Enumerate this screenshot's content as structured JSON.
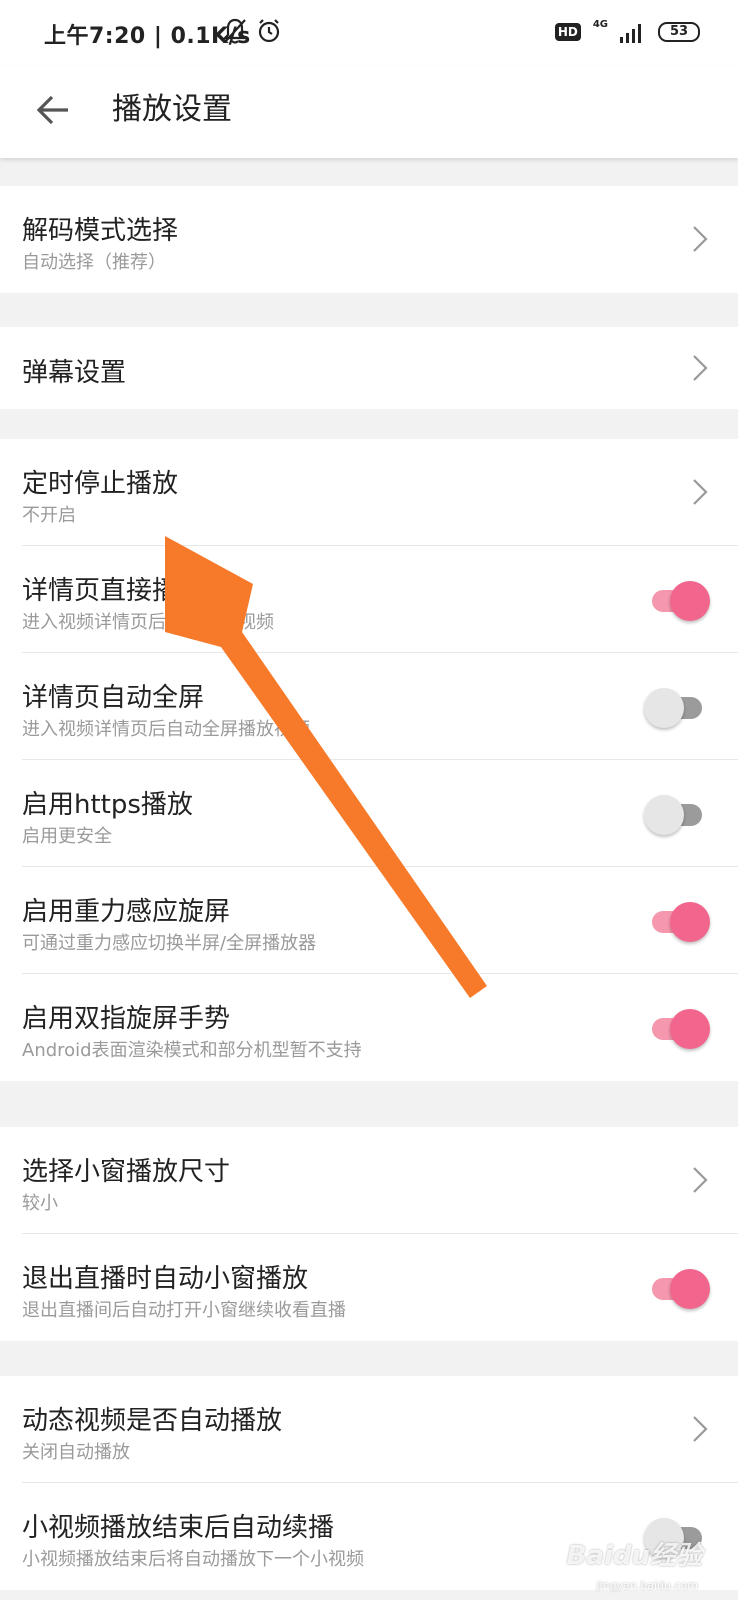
{
  "status_bar": {
    "time_speed": "上午7:20 | 0.1K/s",
    "hd": "HD",
    "network": "4G",
    "battery": "53"
  },
  "app_bar": {
    "title": "播放设置"
  },
  "settings": {
    "decode": {
      "title": "解码模式选择",
      "subtitle": "自动选择（推荐）"
    },
    "danmaku": {
      "title": "弹幕设置"
    },
    "timer": {
      "title": "定时停止播放",
      "subtitle": "不开启"
    },
    "detail_autoplay": {
      "title": "详情页直接播放",
      "subtitle": "进入视频详情页后自动播放视频",
      "enabled": true
    },
    "detail_fullscreen": {
      "title": "详情页自动全屏",
      "subtitle": "进入视频详情页后自动全屏播放视频",
      "enabled": false
    },
    "https": {
      "title": "启用https播放",
      "subtitle": "启用更安全",
      "enabled": false
    },
    "gravity_rotate": {
      "title": "启用重力感应旋屏",
      "subtitle": "可通过重力感应切换半屏/全屏播放器",
      "enabled": true
    },
    "two_finger_rotate": {
      "title": "启用双指旋屏手势",
      "subtitle": "Android表面渲染模式和部分机型暂不支持",
      "enabled": true
    },
    "mini_window_size": {
      "title": "选择小窗播放尺寸",
      "subtitle": "较小"
    },
    "live_mini_window": {
      "title": "退出直播时自动小窗播放",
      "subtitle": "退出直播间后自动打开小窗继续收看直播",
      "enabled": true
    },
    "dynamic_autoplay": {
      "title": "动态视频是否自动播放",
      "subtitle": "关闭自动播放"
    },
    "short_video_continue": {
      "title": "小视频播放结束后自动续播",
      "subtitle": "小视频播放结束后将自动播放下一个小视频",
      "enabled": false
    }
  },
  "watermark": {
    "text": "Baidu经验",
    "url": "jingyan.baidu.com"
  },
  "colors": {
    "toggle_on": "#f2658c",
    "annotation_arrow": "#f77a2a"
  }
}
